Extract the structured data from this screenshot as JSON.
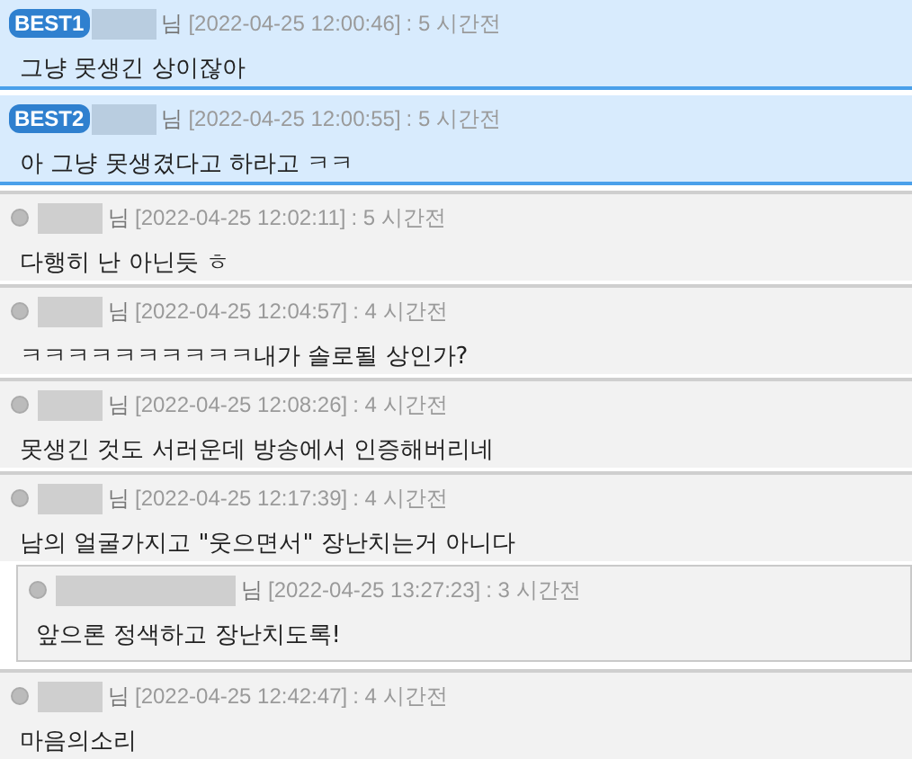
{
  "comments": [
    {
      "kind": "best",
      "badge": "BEST1",
      "honorific": "님",
      "date": "[2022-04-25 12:00:46]",
      "ago": ": 5 시간전",
      "text": "그냥 못생긴 상이잖아"
    },
    {
      "kind": "best",
      "badge": "BEST2",
      "honorific": "님",
      "date": "[2022-04-25 12:00:55]",
      "ago": ": 5 시간전",
      "text": "아 그냥 못생겼다고 하라고 ㅋㅋ"
    },
    {
      "kind": "normal",
      "honorific": "님",
      "date": "[2022-04-25 12:02:11]",
      "ago": ": 5 시간전",
      "text": "다행히 난 아닌듯 ㅎ"
    },
    {
      "kind": "normal",
      "honorific": "님",
      "date": "[2022-04-25 12:04:57]",
      "ago": ": 4 시간전",
      "text": "ㅋㅋㅋㅋㅋㅋㅋㅋㅋㅋ내가 솔로될 상인가?"
    },
    {
      "kind": "normal",
      "honorific": "님",
      "date": "[2022-04-25 12:08:26]",
      "ago": ": 4 시간전",
      "text": "못생긴 것도 서러운데 방송에서 인증해버리네"
    },
    {
      "kind": "normal",
      "honorific": "님",
      "date": "[2022-04-25 12:17:39]",
      "ago": ": 4 시간전",
      "text": "남의 얼굴가지고 \"웃으면서\" 장난치는거 아니다",
      "children": [
        {
          "kind": "normal",
          "honorific": "님",
          "date": "[2022-04-25 13:27:23]",
          "ago": ": 3 시간전",
          "text": "앞으론 정색하고 장난치도록!"
        }
      ]
    },
    {
      "kind": "normal",
      "honorific": "님",
      "date": "[2022-04-25 12:42:47]",
      "ago": ": 4 시간전",
      "text": "마음의소리"
    }
  ]
}
